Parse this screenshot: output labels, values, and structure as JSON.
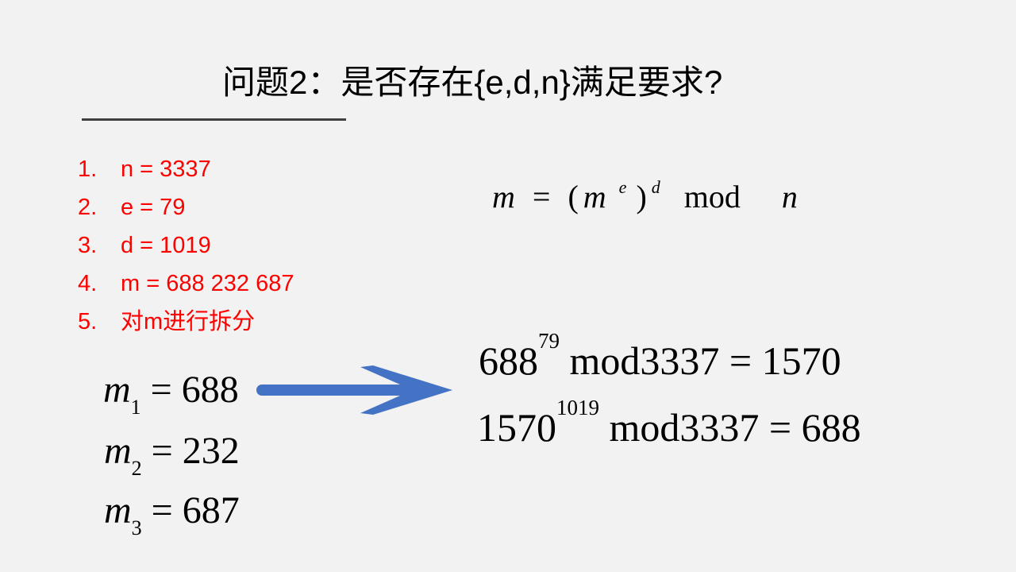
{
  "title": "问题2：是否存在{e,d,n}满足要求?",
  "steps": [
    {
      "num": "1.",
      "text": "n = 3337"
    },
    {
      "num": "2.",
      "text": "e = 79"
    },
    {
      "num": "3.",
      "text": "d = 1019"
    },
    {
      "num": "4.",
      "text": "m = 688 232 687"
    },
    {
      "num": "5.",
      "text": "对m进行拆分"
    }
  ],
  "formula": {
    "lhs": "m",
    "eq": "=",
    "open": "(",
    "base": "m",
    "exp_inner": "e",
    "close": ")",
    "exp_outer": "d",
    "op": "mod",
    "mod": "n"
  },
  "equations": [
    {
      "base": "688",
      "exp": "79",
      "rest": "mod3337 = 1570"
    },
    {
      "base": "1570",
      "exp": "1019",
      "rest": "mod3337 = 688"
    }
  ],
  "parts": [
    {
      "var": "m",
      "sub": "1",
      "value": "= 688"
    },
    {
      "var": "m",
      "sub": "2",
      "value": "= 232"
    },
    {
      "var": "m",
      "sub": "3",
      "value": "= 687"
    }
  ],
  "colors": {
    "background": "#f2f2f2",
    "steps_text": "#ff0000",
    "arrow": "#4472c4",
    "rule": "#404040"
  },
  "icons": {
    "arrow": "right-arrow-icon"
  }
}
